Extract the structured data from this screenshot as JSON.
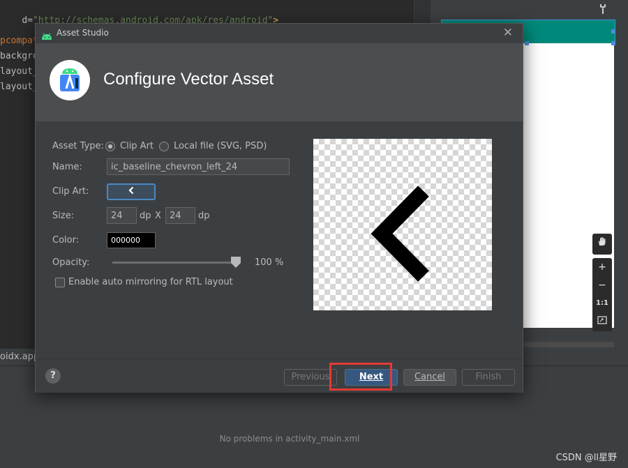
{
  "ide": {
    "code_lines": [
      {
        "prefix": "d=",
        "string": "\"http://schemas.android.com/apk/res/android\"",
        "suffix": ">"
      },
      {
        "prefix": "pcompat",
        "string": "",
        "suffix": ""
      },
      {
        "prefix": "backgro",
        "string": "",
        "suffix": ""
      },
      {
        "prefix": "layout_",
        "string": "",
        "suffix": ""
      },
      {
        "prefix": "layout_",
        "string": "",
        "suffix": ""
      }
    ],
    "bottom_tab_label": "oidx.appc",
    "problems_text": "No problems in activity_main.xml",
    "watermark": "CSDN @ll星野",
    "toolbar_icons": [
      "pan-tool-icon",
      "zoom-in-icon",
      "zoom-out-icon",
      "actual-size-icon",
      "fit-screen-icon"
    ],
    "toolbar_glyphs": {
      "zoom_in": "+",
      "zoom_out": "−",
      "actual_size": "1:1"
    }
  },
  "dialog": {
    "window_title": "Asset Studio",
    "header_title": "Configure Vector Asset",
    "form": {
      "asset_type_label": "Asset Type:",
      "asset_type_options": [
        "Clip Art",
        "Local file (SVG, PSD)"
      ],
      "asset_type_selected": "Clip Art",
      "name_label": "Name:",
      "name_value": "ic_baseline_chevron_left_24",
      "clip_art_label": "Clip Art:",
      "clip_art_icon": "chevron-left-icon",
      "size_label": "Size:",
      "width_value": "24",
      "height_value": "24",
      "unit_dp": "dp",
      "size_separator": "X",
      "color_label": "Color:",
      "color_value": "000000",
      "opacity_label": "Opacity:",
      "opacity_value": "100 %",
      "opacity_level": 1.0,
      "rtl_label": "Enable auto mirroring for RTL layout",
      "rtl_checked": false
    },
    "preview_icon": "chevron-left-icon",
    "buttons": {
      "previous": "Previous",
      "next": "Next",
      "cancel": "Cancel",
      "finish": "Finish",
      "help": "?"
    },
    "colors": {
      "primary_button": "#365880",
      "highlight_box": "#e53935",
      "toolbar_teal": "#00897b"
    }
  }
}
